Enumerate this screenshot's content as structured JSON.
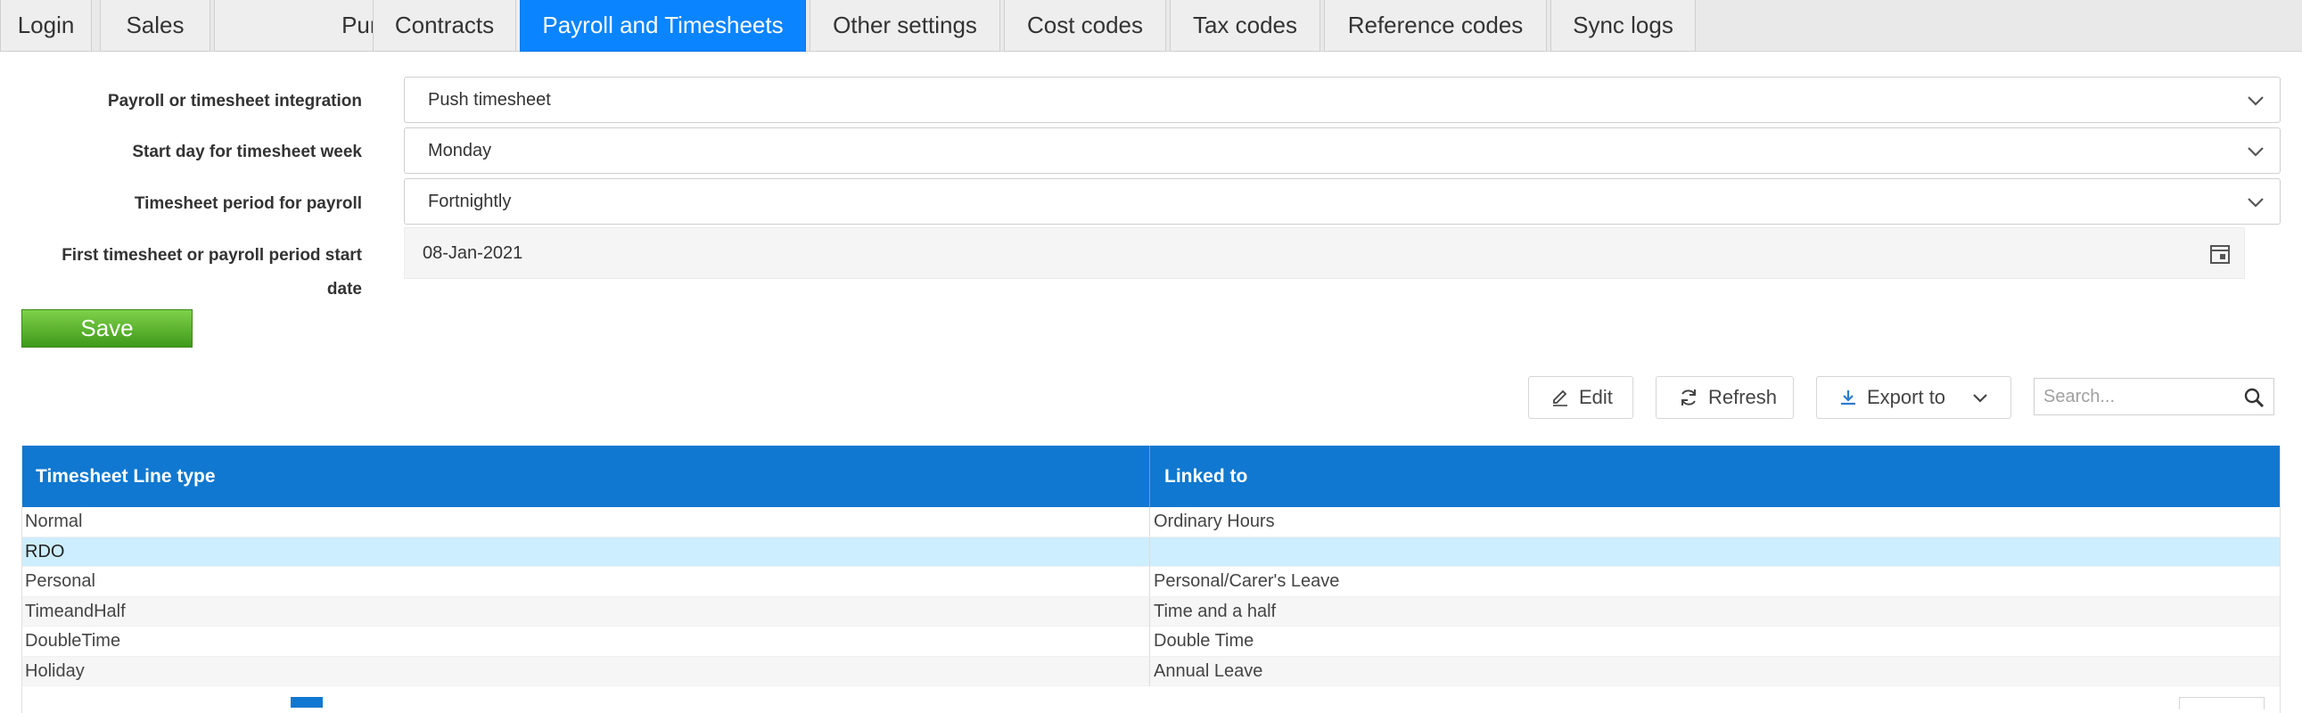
{
  "tabs": [
    {
      "label": "Login",
      "active": false
    },
    {
      "label": "Sales",
      "active": false
    },
    {
      "label": "Purchases",
      "active": false
    },
    {
      "label": "Contracts",
      "active": false
    },
    {
      "label": "Payroll and Timesheets",
      "active": true
    },
    {
      "label": "Other settings",
      "active": false
    },
    {
      "label": "Cost codes",
      "active": false
    },
    {
      "label": "Tax codes",
      "active": false
    },
    {
      "label": "Reference codes",
      "active": false
    },
    {
      "label": "Sync logs",
      "active": false
    }
  ],
  "form": {
    "integration_label": "Payroll or timesheet integration",
    "integration_value": "Push timesheet",
    "start_day_label": "Start day for timesheet week",
    "start_day_value": "Monday",
    "period_label": "Timesheet period for payroll",
    "period_value": "Fortnightly",
    "first_date_label_line1": "First timesheet or payroll period start",
    "first_date_label_line2": "date",
    "first_date_value": "08-Jan-2021",
    "save_label": "Save"
  },
  "toolbar": {
    "edit_label": "Edit",
    "refresh_label": "Refresh",
    "export_label": "Export to",
    "search_placeholder": "Search..."
  },
  "grid": {
    "columns": [
      "Timesheet Line type",
      "Linked to"
    ],
    "rows": [
      {
        "type": "Normal",
        "linked": "Ordinary Hours"
      },
      {
        "type": "RDO",
        "linked": ""
      },
      {
        "type": "Personal",
        "linked": "Personal/Carer's Leave"
      },
      {
        "type": "TimeandHalf",
        "linked": "Time and a half"
      },
      {
        "type": "DoubleTime",
        "linked": "Double Time"
      },
      {
        "type": "Holiday",
        "linked": "Annual Leave"
      }
    ],
    "selected_row": 1
  },
  "colors": {
    "active_tab": "#0a84ff",
    "grid_header": "#1078d0",
    "selected_row": "#cdeeff",
    "save_button": "#4caf2a"
  },
  "icons": {
    "select_chevron": "chevron-down-icon",
    "date_picker": "calendar-icon",
    "edit": "pencil-icon",
    "refresh": "refresh-icon",
    "export": "download-icon",
    "search": "search-icon"
  }
}
